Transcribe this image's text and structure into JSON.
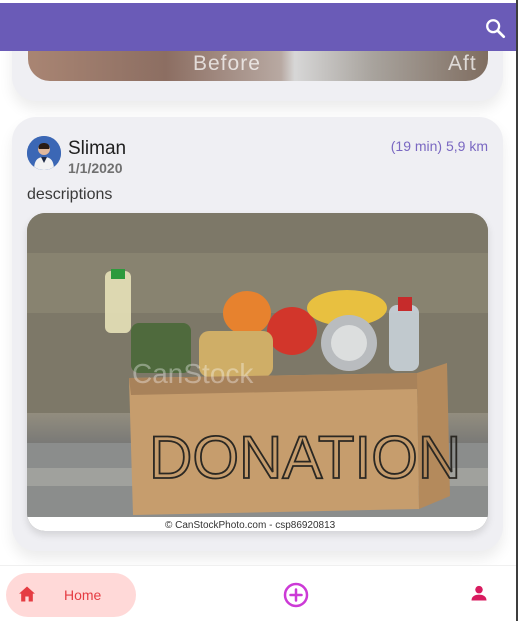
{
  "colors": {
    "appbar": "#6a5bb7",
    "accent": "#7a68c2",
    "home_active_bg": "#ffd9d8",
    "home_active": "#e53c42",
    "add": "#cc3ad6"
  },
  "appbar": {
    "search_icon": "search-icon"
  },
  "posts": [
    {
      "image_text_left": "Before",
      "image_text_right": "Aft"
    },
    {
      "author": "Sliman",
      "date": "1/1/2020",
      "meta": "(19 min) 5,9 km",
      "description": "descriptions",
      "image_label": "DONATION",
      "watermark": "CanStock",
      "credit": "© CanStockPhoto.com - csp86920813"
    }
  ],
  "nav": {
    "home_label": "Home",
    "home_icon": "home-icon",
    "add_icon": "add-circle-icon",
    "profile_icon": "person-icon"
  }
}
